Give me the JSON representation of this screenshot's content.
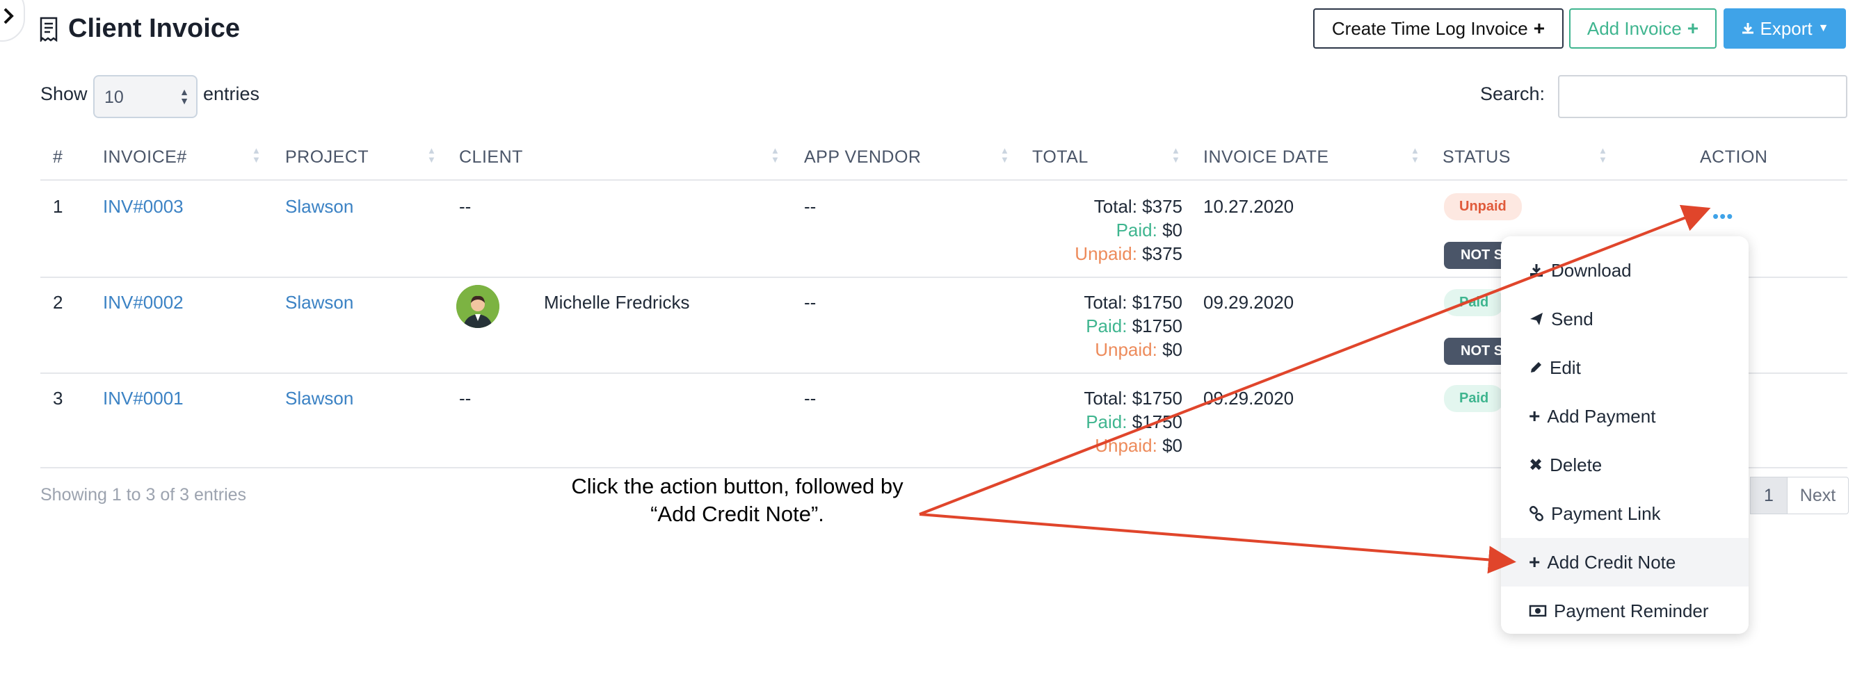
{
  "header": {
    "title": "Client Invoice",
    "create_time_log_label": "Create Time Log Invoice",
    "add_invoice_label": "Add Invoice",
    "export_label": "Export"
  },
  "controls": {
    "show_label": "Show",
    "entries_value": "10",
    "entries_label": "entries",
    "search_label": "Search:",
    "search_value": ""
  },
  "table": {
    "columns": [
      "#",
      "INVOICE#",
      "PROJECT",
      "CLIENT",
      "APP VENDOR",
      "TOTAL",
      "INVOICE DATE",
      "STATUS",
      "ACTION"
    ],
    "rows": [
      {
        "num": "1",
        "invoice": "INV#0003",
        "project": "Slawson",
        "client": "--",
        "vendor": "--",
        "total": "Total: $375",
        "paid_label": "Paid:",
        "paid": "$0",
        "unpaid_label": "Unpaid:",
        "unpaid": "$375",
        "date": "10.27.2020",
        "status": "Unpaid",
        "send_status": "NOT SENT"
      },
      {
        "num": "2",
        "invoice": "INV#0002",
        "project": "Slawson",
        "client": "Michelle Fredricks",
        "vendor": "--",
        "total": "Total: $1750",
        "paid_label": "Paid:",
        "paid": "$1750",
        "unpaid_label": "Unpaid:",
        "unpaid": "$0",
        "date": "09.29.2020",
        "status": "Paid",
        "send_status": "NOT SENT"
      },
      {
        "num": "3",
        "invoice": "INV#0001",
        "project": "Slawson",
        "client": "--",
        "vendor": "--",
        "total": "Total: $1750",
        "paid_label": "Paid:",
        "paid": "$1750",
        "unpaid_label": "Unpaid:",
        "unpaid": "$0",
        "date": "09.29.2020",
        "status": "Paid"
      }
    ]
  },
  "action_menu": {
    "items": [
      "Download",
      "Send",
      "Edit",
      "Add Payment",
      "Delete",
      "Payment Link",
      "Add Credit Note",
      "Payment Reminder"
    ]
  },
  "footer": {
    "showing": "Showing 1 to 3 of 3 entries",
    "page": "1",
    "next": "Next"
  },
  "annotation": {
    "line1": "Click the action button, followed by",
    "line2": "“Add Credit Note”.",
    "arrow_color": "#e0452b"
  },
  "colors": {
    "accent_blue": "#3fa3e8",
    "green": "#3fb58f",
    "orange": "#ed8b5b",
    "link": "#3b82c4"
  }
}
